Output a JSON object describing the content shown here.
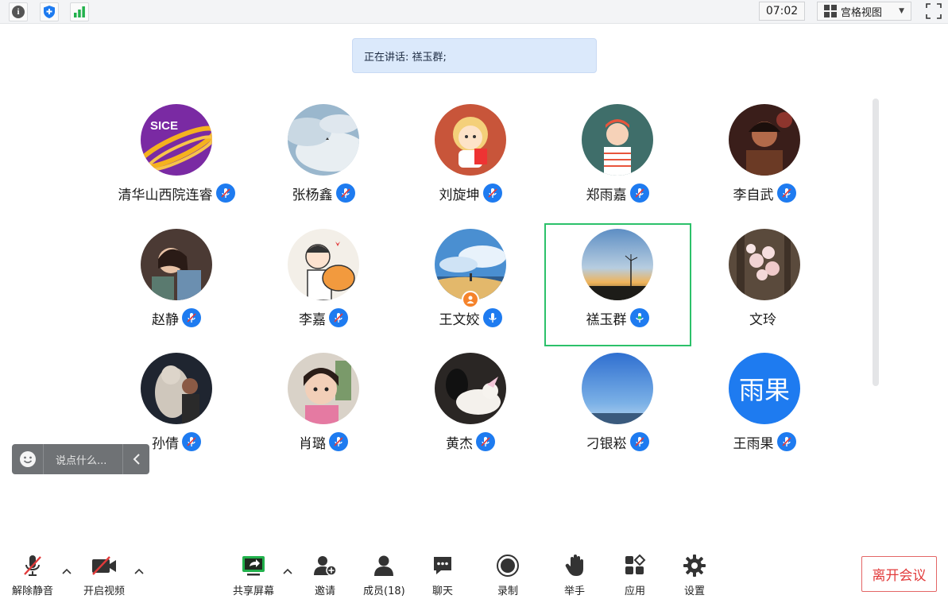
{
  "topbar": {
    "time": "07:02",
    "view_label": "宫格视图",
    "icons": [
      "info-icon",
      "shield-icon",
      "signal-icon",
      "grid-view-icon",
      "fullscreen-icon"
    ]
  },
  "speaking": {
    "label": "正在讲话: 禚玉群;"
  },
  "participants": [
    {
      "name": "清华山西院连睿",
      "mic": "muted"
    },
    {
      "name": "张杨鑫",
      "mic": "muted"
    },
    {
      "name": "刘旋坤",
      "mic": "muted"
    },
    {
      "name": "郑雨嘉",
      "mic": "muted"
    },
    {
      "name": "李自武",
      "mic": "muted"
    },
    {
      "name": "赵静",
      "mic": "muted"
    },
    {
      "name": "李嘉",
      "mic": "muted"
    },
    {
      "name": "王文姣",
      "mic": "on",
      "host": true
    },
    {
      "name": "禚玉群",
      "mic": "speaking",
      "active": true
    },
    {
      "name": "文玲",
      "mic": "none"
    },
    {
      "name": "孙倩",
      "mic": "muted"
    },
    {
      "name": "肖璐",
      "mic": "muted"
    },
    {
      "name": "黄杰",
      "mic": "muted"
    },
    {
      "name": "刁银崧",
      "mic": "muted"
    },
    {
      "name": "王雨果",
      "mic": "muted"
    }
  ],
  "avatar_texts": {
    "sice": "SICE",
    "yuguo": "雨果"
  },
  "chat": {
    "placeholder": "说点什么..."
  },
  "toolbar": {
    "unmute": "解除静音",
    "start_video": "开启视频",
    "share_screen": "共享屏幕",
    "invite": "邀请",
    "members": "成员(18)",
    "chat": "聊天",
    "record": "录制",
    "raise_hand": "举手",
    "apps": "应用",
    "settings": "设置",
    "leave": "离开会议"
  },
  "colors": {
    "accent": "#1e7bf0",
    "active_border": "#2cc16a",
    "leave": "#e23b3b",
    "speaking_bg": "#dbe9fb"
  }
}
